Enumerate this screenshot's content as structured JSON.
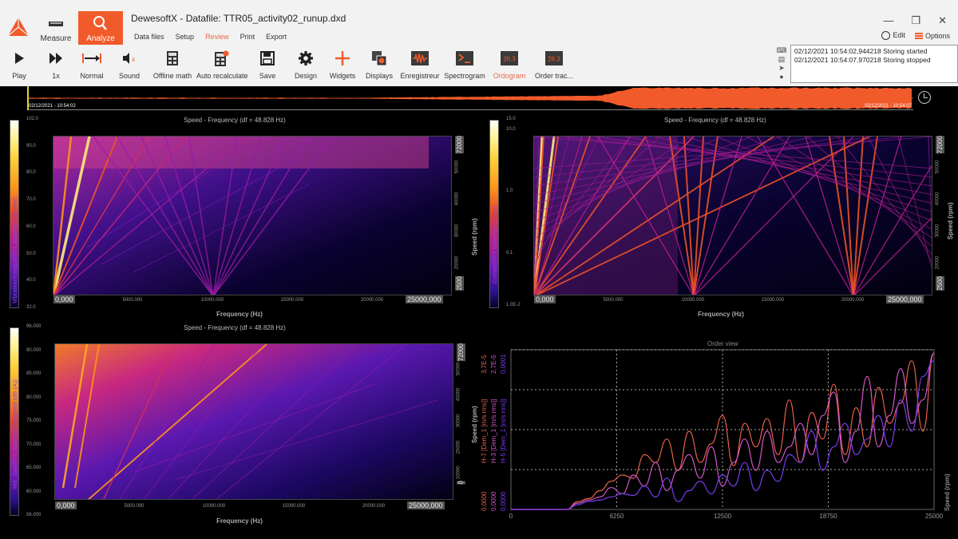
{
  "window": {
    "title": "DewesoftX - Datafile: TTR05_activity02_runup.dxd",
    "controls": [
      "minimize",
      "restore",
      "close"
    ],
    "edit_label": "Edit",
    "options_label": "Options"
  },
  "modes": [
    {
      "label": "Measure",
      "icon": "ruler-icon",
      "active": false
    },
    {
      "label": "Analyze",
      "icon": "search-icon",
      "active": true
    }
  ],
  "menu": [
    {
      "label": "Data files",
      "active": false
    },
    {
      "label": "Setup",
      "active": false
    },
    {
      "label": "Review",
      "active": true
    },
    {
      "label": "Print",
      "active": false
    },
    {
      "label": "Export",
      "active": false
    }
  ],
  "toolbar": [
    {
      "label": "Play",
      "icon": "play-icon"
    },
    {
      "label": "1x",
      "icon": "fast-forward-icon"
    },
    {
      "label": "Normal",
      "icon": "normal-range-icon"
    },
    {
      "label": "Sound",
      "icon": "sound-muted-icon"
    },
    {
      "label": "Offline math",
      "icon": "calculator-icon"
    },
    {
      "label": "Auto recalculate",
      "icon": "auto-recalculate-icon"
    },
    {
      "label": "Save",
      "icon": "save-icon"
    },
    {
      "label": "Design",
      "icon": "gear-icon"
    },
    {
      "label": "Widgets",
      "icon": "plus-icon"
    },
    {
      "label": "Displays",
      "icon": "displays-icon"
    },
    {
      "label": "Enregistreur",
      "icon": "recorder-icon"
    },
    {
      "label": "Spectrogram",
      "icon": "spectrogram-icon"
    },
    {
      "label": "Ordogram",
      "icon": "ordogram-icon",
      "selected": true
    },
    {
      "label": "Order trac...",
      "icon": "order-tracking-icon"
    }
  ],
  "toolbar_icon_text": {
    "ordogram": "26.3",
    "order_tracking": "26.3"
  },
  "event_log": [
    "02/12/2021 10:54:02,944218 Storing started",
    "02/12/2021 10:54:07,970218 Storing stopped"
  ],
  "overview": {
    "start_time": "02/12/2021 - 10:54:02",
    "end_time": "02/12/2021 - 10:54:07",
    "color": "#f15a2b"
  },
  "chart_data": [
    {
      "type": "heatmap",
      "title": "Speed - Frequency (df = 48.828 Hz)",
      "xlabel": "Frequency (Hz)",
      "ylabel": "Speed (rpm)",
      "x_ticks": [
        "0,000",
        "5000.000",
        "10000.000",
        "15000.000",
        "20000.000",
        "25000,000"
      ],
      "xlim": [
        0,
        25000
      ],
      "y_ticks": [
        "2500",
        "20000",
        "30000",
        "40000",
        "50000",
        "72000"
      ],
      "ylim": [
        2500,
        72000
      ],
      "colorbar": {
        "label": "Vibration/Integral/FFT waterfall (dB m/s)",
        "ticks": [
          "102.0",
          "90.0",
          "80.0",
          "70.0",
          "60.0",
          "50.0",
          "40.0",
          "32.0"
        ],
        "range": [
          32.0,
          102.0
        ]
      }
    },
    {
      "type": "heatmap",
      "title": "Speed - Frequency (df = 48.828 Hz)",
      "xlabel": "Frequency (Hz)",
      "ylabel": "Speed (rpm)",
      "x_ticks": [
        "0,000",
        "5000.000",
        "10000.000",
        "15000.000",
        "20000.000",
        "25000,000"
      ],
      "xlim": [
        0,
        25000
      ],
      "y_ticks": [
        "2500",
        "20000",
        "30000",
        "40000",
        "50000",
        "72000"
      ],
      "ylim": [
        2500,
        72000
      ],
      "colorbar": {
        "label": "Current/FFT waterfall (A rms)",
        "ticks": [
          "15.0",
          "10.0",
          "1.0",
          "0.1",
          "1.0E-2"
        ],
        "range": [
          0.01,
          15.0
        ],
        "scale": "log"
      }
    },
    {
      "type": "heatmap",
      "title": "Speed - Frequency (df = 48.828 Hz)",
      "xlabel": "Frequency (Hz)",
      "ylabel": "Speed (rpm)",
      "x_ticks": [
        "0,000",
        "5000.000",
        "10000.000",
        "15000.000",
        "20000.000",
        "25000,000"
      ],
      "xlim": [
        0,
        25000
      ],
      "y_ticks": [
        "0",
        "10000",
        "20000",
        "30000",
        "40000",
        "50000",
        "72000"
      ],
      "ylim": [
        0,
        72000
      ],
      "colorbar": {
        "label": "Mic_Sou/FFT waterfall/Weighted (dB (A))",
        "ticks": [
          "96.000",
          "90.000",
          "85.000",
          "80.000",
          "75.000",
          "70.000",
          "65.000",
          "60.000",
          "56.000"
        ],
        "range": [
          56.0,
          96.0
        ]
      }
    },
    {
      "type": "line",
      "title": "Order view",
      "xlabel": "Speed (rpm)",
      "x": [
        0,
        6250,
        12500,
        18750,
        25000
      ],
      "xlim": [
        0,
        25000
      ],
      "x_ticks": [
        "0",
        "6250",
        "12500",
        "18750",
        "25000"
      ],
      "grid": true,
      "series": [
        {
          "name": "H-7 [Dem_1 [m/s rms]]",
          "color": "#e8604a",
          "ylim": [
            0.0,
            3.7e-05
          ],
          "y_top_label": "3,7E-5",
          "y_bottom_label": "0,0000",
          "values": [
            0,
            0,
            0,
            0,
            0,
            0,
            0.05,
            0.07,
            0.12,
            0.18,
            0.22,
            0.2,
            0.35,
            0.3,
            0.45,
            0.25,
            0.5,
            0.3,
            0.42,
            0.6,
            0.28,
            0.55,
            0.4,
            0.58,
            0.35,
            0.7,
            0.3,
            0.62,
            0.45,
            0.8,
            0.35,
            0.65,
            0.4,
            0.78,
            0.55,
            0.68,
            0.95,
            0.5,
            1.0
          ]
        },
        {
          "name": "H-3 [Dem_1 [m/s rms]]",
          "color": "#d455c8",
          "ylim": [
            0.0,
            2.7e-05
          ],
          "y_top_label": "2,7E-5",
          "y_bottom_label": "0,0000",
          "values": [
            0,
            0,
            0,
            0,
            0,
            0,
            0.04,
            0.06,
            0.08,
            0.14,
            0.1,
            0.22,
            0.15,
            0.3,
            0.12,
            0.25,
            0.35,
            0.2,
            0.4,
            0.15,
            0.3,
            0.45,
            0.25,
            0.5,
            0.3,
            0.4,
            0.55,
            0.35,
            0.6,
            0.75,
            0.3,
            0.5,
            0.85,
            0.4,
            0.6,
            0.9,
            0.55,
            0.7,
            1.0
          ]
        },
        {
          "name": "H-5 [Dem_1 [m/s rms]]",
          "color": "#7a3cf0",
          "ylim": [
            0.0,
            0.0001
          ],
          "y_top_label": "0,0001",
          "y_bottom_label": "0,0000",
          "values": [
            0,
            0,
            0,
            0,
            0,
            0,
            0.03,
            0.05,
            0.06,
            0.08,
            0.1,
            0.09,
            0.15,
            0.08,
            0.2,
            0.05,
            0.12,
            0.18,
            0.1,
            0.22,
            0.15,
            0.3,
            0.12,
            0.25,
            0.18,
            0.35,
            0.3,
            0.5,
            0.25,
            0.4,
            0.55,
            0.35,
            0.45,
            0.6,
            0.4,
            0.7,
            0.5,
            0.85,
            0.95
          ]
        }
      ]
    }
  ]
}
